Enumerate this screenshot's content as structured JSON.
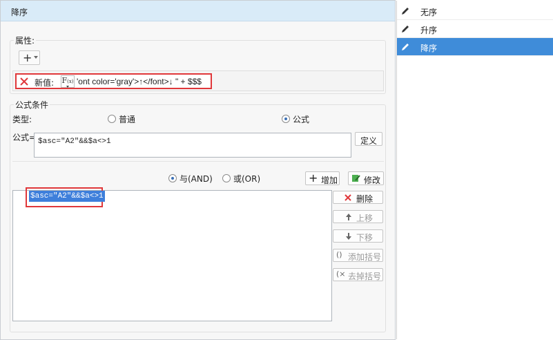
{
  "dialog": {
    "title": "降序",
    "attributes_label": "属性:",
    "property_row": {
      "label": "新值:",
      "value": "'ont color='gray'>↑</font>↓ \" + $$$"
    },
    "condition_section_label": "公式条件",
    "type_label": "类型:",
    "type_options": [
      {
        "label": "普通",
        "selected": false
      },
      {
        "label": "公式",
        "selected": true
      }
    ],
    "formula_label": "公式=",
    "formula_value": "$asc=\"A2\"&&$a<>1",
    "define_button": "定义",
    "logic_options": [
      {
        "label": "与(AND)",
        "selected": true
      },
      {
        "label": "或(OR)",
        "selected": false
      }
    ],
    "add_button": "增加",
    "modify_button": "修改",
    "conditions": [
      "$asc=\"A2\"&&$a<>1"
    ],
    "side_buttons": {
      "delete": "删除",
      "move_up": "上移",
      "move_down": "下移",
      "add_bracket": "添加括号",
      "remove_bracket": "去掉括号"
    }
  },
  "sort_list": {
    "items": [
      {
        "label": "无序",
        "selected": false
      },
      {
        "label": "升序",
        "selected": false
      },
      {
        "label": "降序",
        "selected": true
      }
    ]
  },
  "colors": {
    "title_bar": "#d9ebf8",
    "selection": "#3f8cd9",
    "highlight_border": "#e0373a"
  }
}
